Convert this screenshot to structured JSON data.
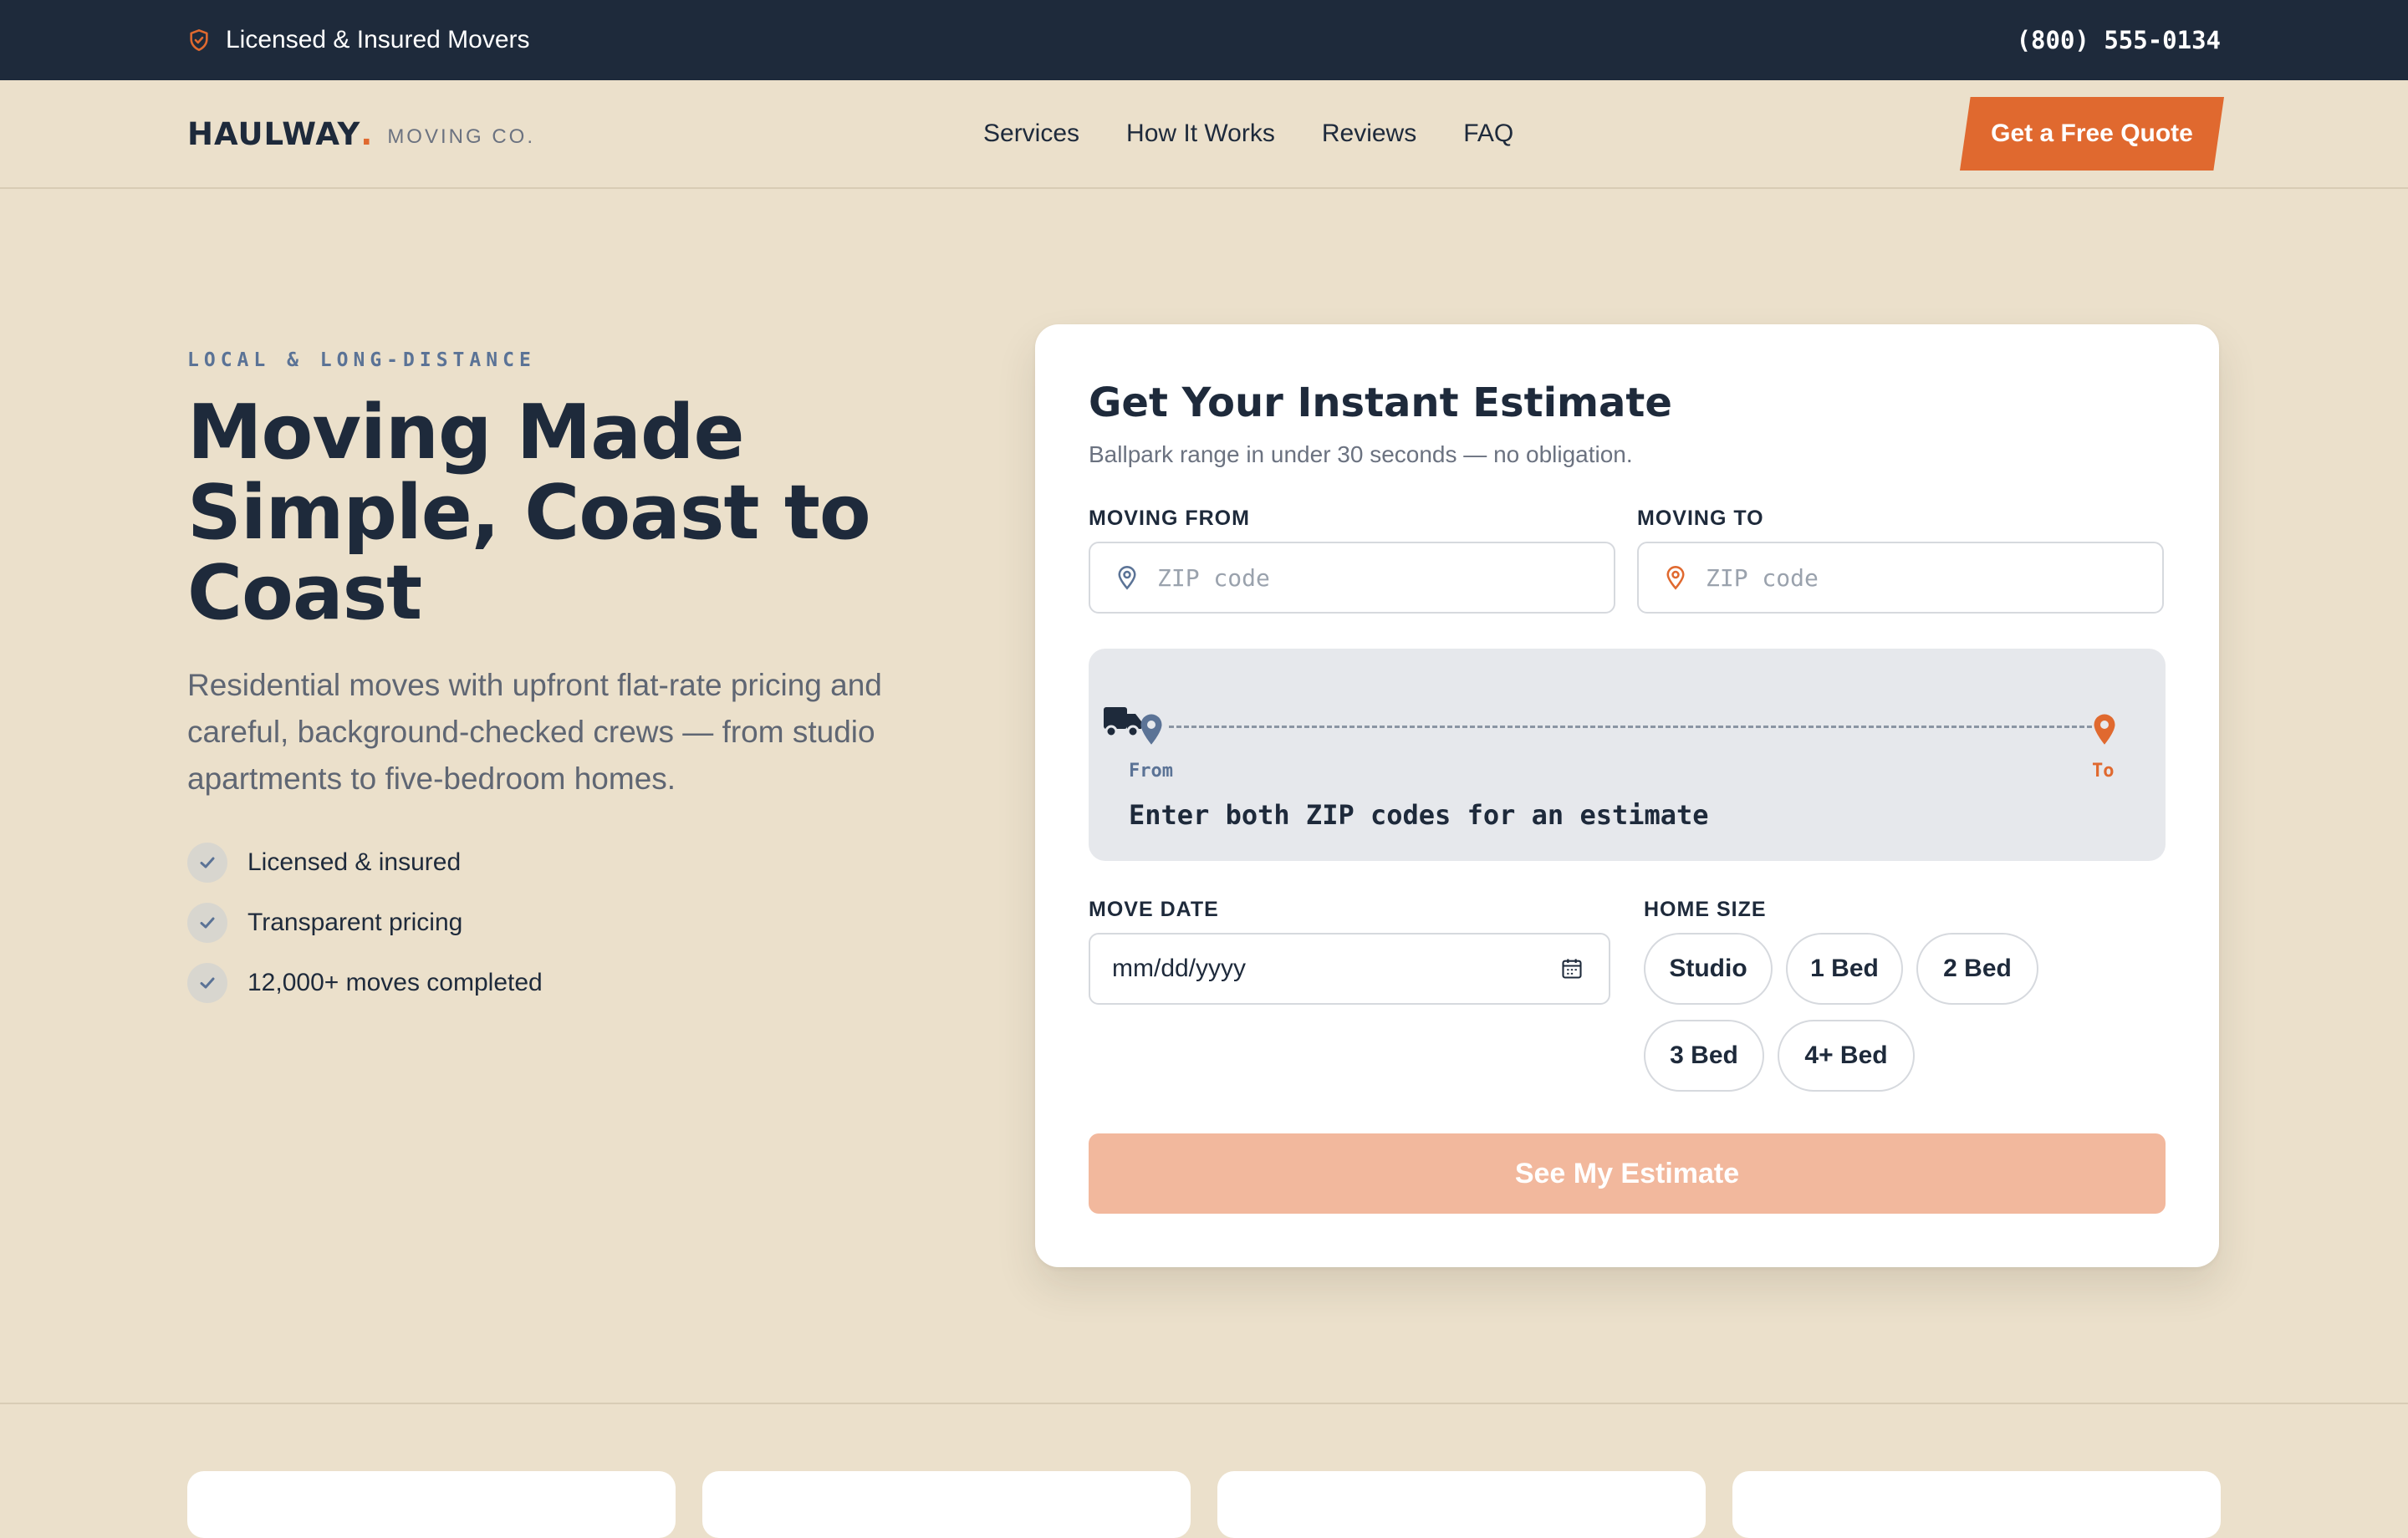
{
  "topbar": {
    "licensed_text": "Licensed & Insured Movers",
    "phone": "(800) 555-0134"
  },
  "header": {
    "brand": "HAULWAY",
    "brand_dot": ".",
    "brand_sub": "MOVING CO.",
    "nav": [
      "Services",
      "How It Works",
      "Reviews",
      "FAQ"
    ],
    "cta_label": "Get a Free Quote"
  },
  "hero": {
    "eyebrow": "LOCAL & LONG-DISTANCE",
    "title": "Moving Made Simple, Coast to Coast",
    "description": "Residential moves with upfront flat-rate pricing and careful, background-checked crews — from studio apartments to five-bedroom homes.",
    "checks": [
      "Licensed & insured",
      "Transparent pricing",
      "12,000+ moves completed"
    ]
  },
  "estimate": {
    "title": "Get Your Instant Estimate",
    "subtitle": "Ballpark range in under 30 seconds — no obligation.",
    "from_label": "MOVING FROM",
    "from_placeholder": "ZIP code",
    "to_label": "MOVING TO",
    "to_placeholder": "ZIP code",
    "route": {
      "from_label": "From",
      "to_label": "To",
      "message": "Enter both ZIP codes for an estimate"
    },
    "date_label": "MOVE DATE",
    "date_value": "mm/dd/yyyy",
    "size_label": "HOME SIZE",
    "sizes": [
      "Studio",
      "1 Bed",
      "2 Bed",
      "3 Bed",
      "4+ Bed"
    ],
    "submit_label": "See My Estimate"
  },
  "colors": {
    "navy": "#1e2a3b",
    "accent": "#e0692f",
    "background": "#ebe0cb",
    "accent_disabled": "#f2b89d",
    "slate_blue": "#5b7396"
  },
  "icons": {
    "topbar": "shield-check-icon",
    "check": "check-icon",
    "from_pin": "map-pin-icon",
    "to_pin": "map-pin-icon",
    "truck": "truck-icon",
    "date": "calendar-icon"
  }
}
